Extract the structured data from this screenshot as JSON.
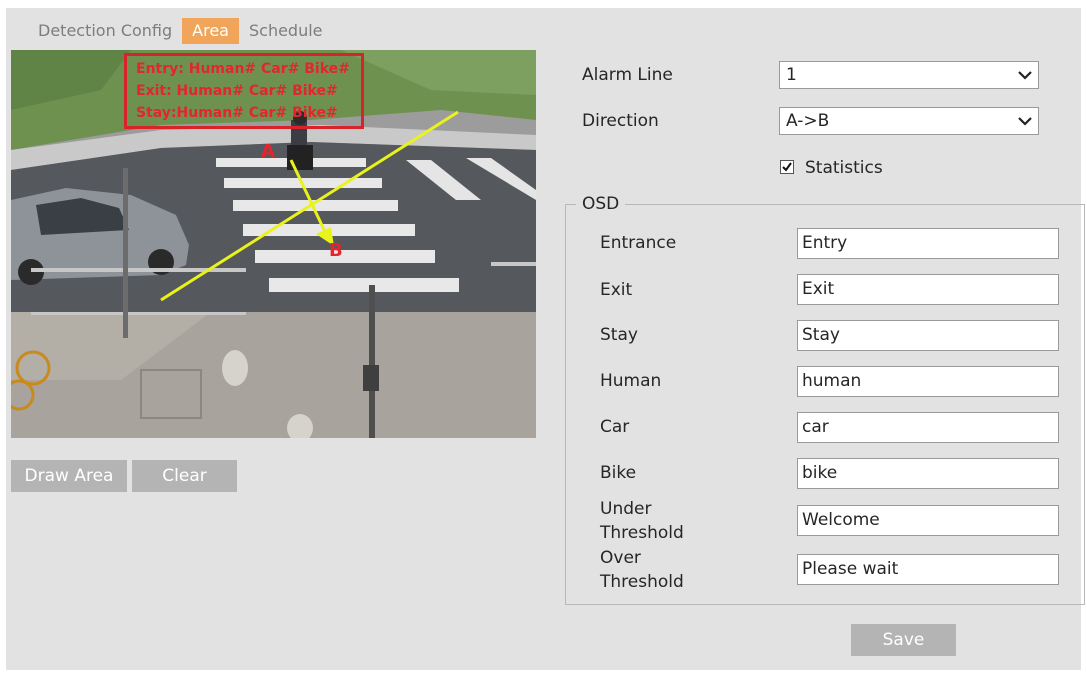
{
  "tabs": [
    {
      "label": "Detection Config",
      "active": false
    },
    {
      "label": "Area",
      "active": true
    },
    {
      "label": "Schedule",
      "active": false
    }
  ],
  "video": {
    "overlay_lines": [
      "Entry:  Human# Car# Bike#",
      "Exit: Human# Car# Bike#",
      "Stay:Human# Car# Bike#"
    ],
    "marker_a": "A",
    "marker_b": "B",
    "overlay_color": "#e3262d",
    "line_color": "#eaf21c"
  },
  "buttons": {
    "draw_area": "Draw Area",
    "clear": "Clear",
    "save": "Save"
  },
  "alarm_line": {
    "label": "Alarm Line",
    "value": "1"
  },
  "direction": {
    "label": "Direction",
    "value": "A->B"
  },
  "statistics": {
    "label": "Statistics",
    "checked": true
  },
  "osd": {
    "legend": "OSD",
    "fields": [
      {
        "label": "Entrance",
        "value": "Entry"
      },
      {
        "label": "Exit",
        "value": "Exit"
      },
      {
        "label": "Stay",
        "value": "Stay"
      },
      {
        "label": "Human",
        "value": "human"
      },
      {
        "label": "Car",
        "value": "car"
      },
      {
        "label": "Bike",
        "value": "bike"
      },
      {
        "label_lines": [
          "Under",
          "Threshold"
        ],
        "value": "Welcome"
      },
      {
        "label_lines": [
          "Over",
          "Threshold"
        ],
        "value": "Please wait"
      }
    ]
  },
  "colors": {
    "active_tab": "#f0a55b",
    "button": "#b4b4b4",
    "panel": "#e2e2e2"
  }
}
